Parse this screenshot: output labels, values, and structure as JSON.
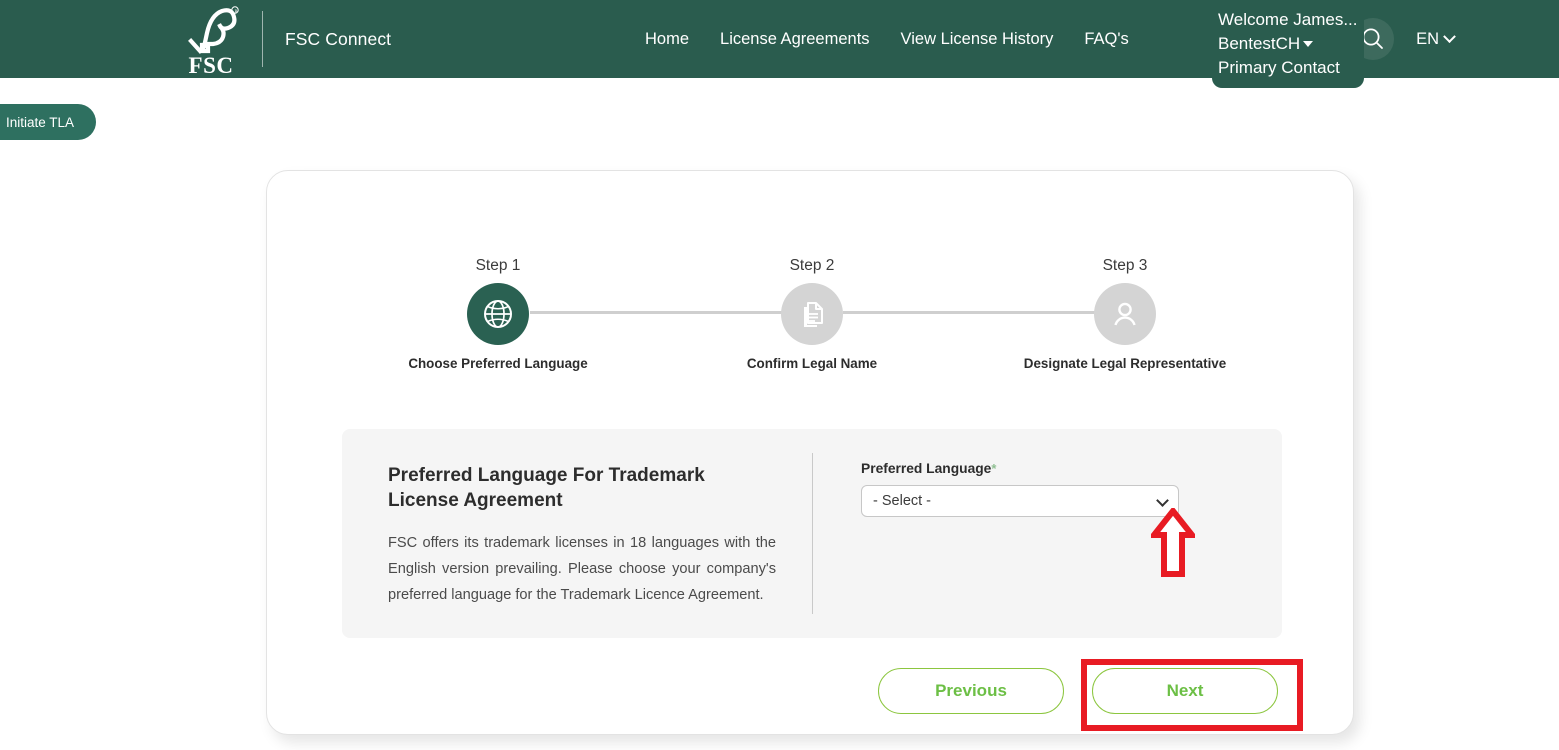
{
  "header": {
    "brand_name": "FSC Connect",
    "logo_text": "FSC",
    "logo_reg_mark": "®",
    "nav": [
      {
        "label": "Home"
      },
      {
        "label": "License Agreements"
      },
      {
        "label": "View License History"
      },
      {
        "label": "FAQ's"
      }
    ],
    "apps_icon": "apps-grid-icon",
    "avatar_icon": "user-avatar-icon",
    "search_icon": "search-icon",
    "user": {
      "welcome": "Welcome James...",
      "account": "BentestCH",
      "role": "Primary Contact"
    },
    "language": {
      "value": "EN"
    }
  },
  "side_tab": {
    "label": "Initiate TLA"
  },
  "stepper": {
    "steps": [
      {
        "number": "Step 1",
        "label": "Choose Preferred Language",
        "icon": "globe-icon",
        "state": "active"
      },
      {
        "number": "Step 2",
        "label": "Confirm Legal Name",
        "icon": "documents-icon",
        "state": "inactive"
      },
      {
        "number": "Step 3",
        "label": "Designate Legal Representative",
        "icon": "person-icon",
        "state": "inactive"
      }
    ]
  },
  "panel": {
    "title": "Preferred Language For Trademark License Agreement",
    "body": "FSC offers its trademark licenses in 18 languages with the English version prevailing. Please choose your company's preferred language for the Trademark Licence Agreement.",
    "field": {
      "label": "Preferred Language",
      "required_marker": "*",
      "selected_value": "- Select -",
      "options": [
        "- Select -"
      ]
    }
  },
  "actions": {
    "previous_label": "Previous",
    "next_label": "Next"
  },
  "colors": {
    "header_green": "#2a5c4e",
    "step_active_green": "#2a6152",
    "button_green": "#8cc63f",
    "button_text_green": "#6cbf45",
    "annotation_red": "#e81b23",
    "panel_gray": "#f5f5f5"
  },
  "annotations": {
    "arrow": "red-up-arrow-annotation",
    "box": "red-rectangle-annotation"
  }
}
